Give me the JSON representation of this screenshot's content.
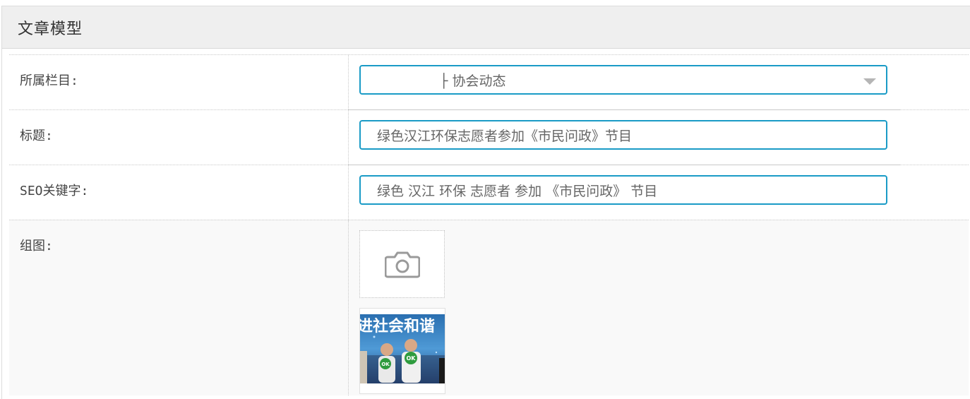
{
  "panel": {
    "title": "文章模型"
  },
  "form": {
    "category": {
      "label": "所属栏目:",
      "value": "├ 协会动态"
    },
    "title": {
      "label": "标题:",
      "value": "绿色汉江环保志愿者参加《市民问政》节目"
    },
    "seo_keywords": {
      "label": "SEO关键字:",
      "value": "绿色 汉江 环保 志愿者 参加 《市民问政》 节目"
    },
    "gallery": {
      "label": "组图:",
      "upload_icon": "camera-icon",
      "thumbnail_count": 1,
      "thumbnail_banner_text": "进社会和谐",
      "thumbnail_badge": "OK"
    }
  },
  "colors": {
    "accent": "#1a9bc6",
    "header_bg": "#efefef",
    "row_bg": "#f9f9f9"
  }
}
